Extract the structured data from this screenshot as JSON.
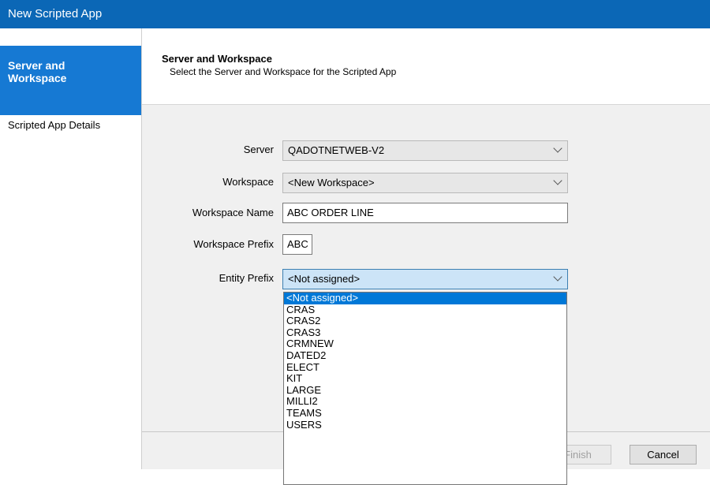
{
  "window": {
    "title": "New Scripted App"
  },
  "sidebar": {
    "active_item": "Server and Workspace",
    "items": [
      {
        "label": "Server and\nWorkspace"
      },
      {
        "label": "Scripted App Details"
      }
    ]
  },
  "header": {
    "title": "Server and Workspace",
    "subtitle": "Select the Server and Workspace for the Scripted App"
  },
  "form": {
    "server": {
      "label": "Server",
      "value": "QADOTNETWEB-V2"
    },
    "workspace": {
      "label": "Workspace",
      "value": "<New Workspace>"
    },
    "workspace_name": {
      "label": "Workspace Name",
      "value": "ABC ORDER LINE"
    },
    "workspace_prefix": {
      "label": "Workspace Prefix",
      "value": "ABC"
    },
    "entity_prefix": {
      "label": "Entity Prefix",
      "value": "<Not assigned>",
      "options": [
        "<Not assigned>",
        "CRAS",
        "CRAS2",
        "CRAS3",
        "CRMNEW",
        "DATED2",
        "ELECT",
        "KIT",
        "LARGE",
        "MILLI2",
        "TEAMS",
        "USERS"
      ],
      "selected_index": 0
    }
  },
  "buttons": {
    "finish_label": "Finish",
    "cancel_label": "Cancel"
  },
  "colors": {
    "titlebar": "#0b67b6",
    "sidebar_active": "#1679d3",
    "selection": "#0078d7",
    "content_bg": "#f0f0f0"
  }
}
